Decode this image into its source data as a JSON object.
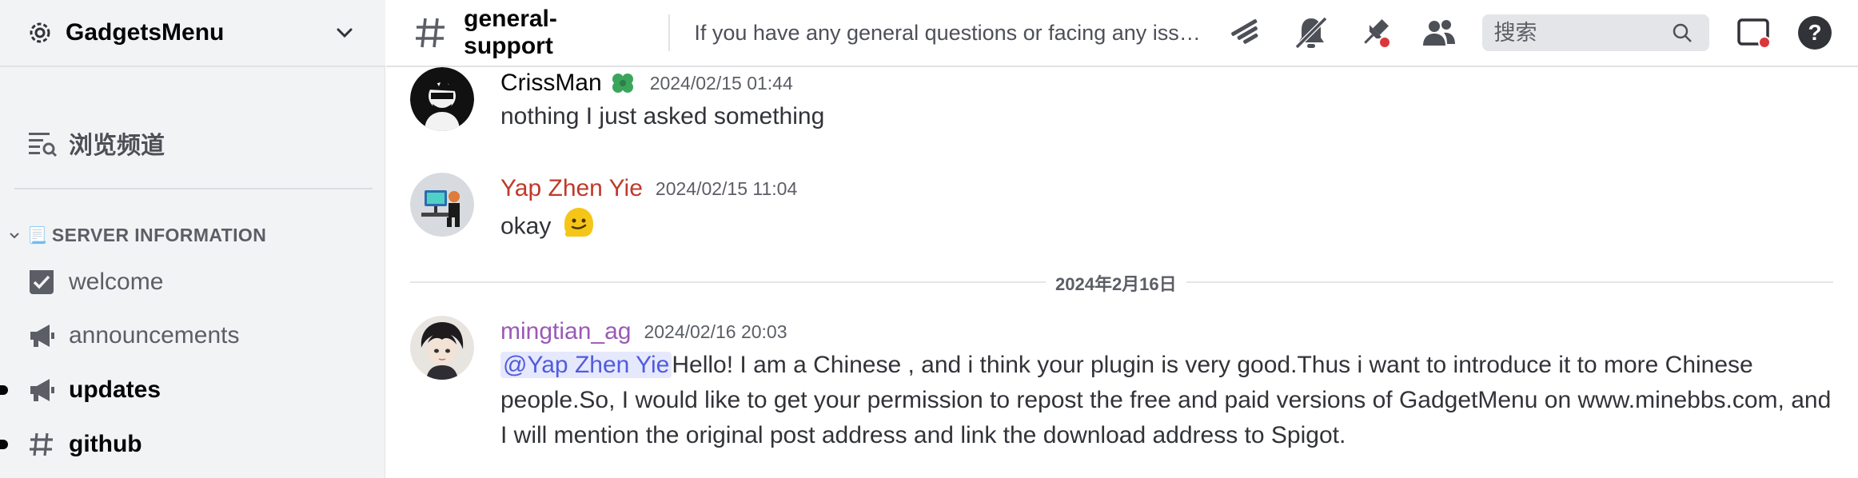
{
  "server": {
    "name": "GadgetsMenu"
  },
  "sidebar": {
    "browse_label": "浏览频道",
    "category": {
      "emoji": "📃",
      "label": "SERVER INFORMATION"
    },
    "channels": [
      {
        "label": "welcome",
        "icon": "rules-checkbox-icon",
        "unread": false
      },
      {
        "label": "announcements",
        "icon": "megaphone-icon",
        "unread": false
      },
      {
        "label": "updates",
        "icon": "megaphone-icon",
        "unread": true
      },
      {
        "label": "github",
        "icon": "hash-icon",
        "unread": true
      }
    ]
  },
  "header": {
    "channel_name": "general-support",
    "topic": "If you have any general questions or facing any issue, ...",
    "search_placeholder": "搜索"
  },
  "messages": [
    {
      "username": "CrissMan",
      "username_color": "#060607",
      "timestamp": "2024/02/15 01:44",
      "text": "nothing I just asked something",
      "has_badge": true
    },
    {
      "username": "Yap Zhen Yie",
      "username_color": "#c0392b",
      "timestamp": "2024/02/15 11:04",
      "text": "okay",
      "emoji": "🫠"
    },
    {
      "username": "mingtian_ag",
      "username_color": "#9b59b6",
      "timestamp": "2024/02/16 20:03",
      "mention": "@Yap Zhen Yie",
      "text": "Hello! I am a Chinese , and i think your plugin is very good.Thus i want to introduce it to more Chinese people.So, I would like to get your permission to repost the free and paid versions of GadgetMenu on www.minebbs.com, and I will mention the original post address and link the download address to Spigot."
    }
  ],
  "date_divider": "2024年2月16日",
  "colors": {
    "accent": "#5865f2",
    "mention_bg": "#e6e8fd",
    "notification_red": "#da373c"
  }
}
